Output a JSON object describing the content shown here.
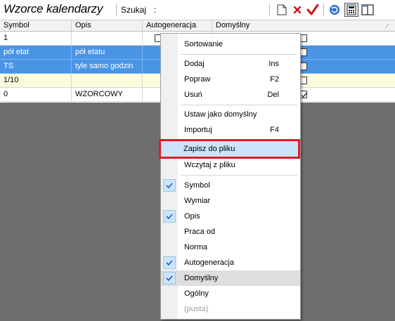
{
  "toolbar": {
    "title": "Wzorce kalendarzy",
    "search_label": "Szukaj",
    "search_colon": ":",
    "search_value": "",
    "icons": [
      "new-document-icon",
      "delete-icon",
      "confirm-check-icon",
      "refresh-icon",
      "calculator-icon",
      "panel-view-icon"
    ],
    "colors": {
      "delete": "#d0141a",
      "confirm": "#d0141a",
      "refresh": "#2f6fd6"
    }
  },
  "grid": {
    "columns": [
      "Symbol",
      "Opis",
      "Autogeneracja",
      "Domyślny"
    ],
    "rows": [
      {
        "symbol": "1",
        "opis": "",
        "domyslny": false,
        "style": "normal"
      },
      {
        "symbol": "pół etat",
        "opis": "pół etatu",
        "domyslny": false,
        "style": "selected"
      },
      {
        "symbol": "TS",
        "opis": "tyle samo godzin",
        "domyslny": false,
        "style": "selected"
      },
      {
        "symbol": "1/10",
        "opis": "",
        "domyslny": false,
        "style": "new"
      },
      {
        "symbol": "0",
        "opis": "WZORCOWY",
        "domyslny": true,
        "style": "normal"
      }
    ],
    "colors": {
      "selected": "#4a94e6",
      "new": "#fdfbdb",
      "background": "#6e6e6e"
    }
  },
  "context_menu": {
    "sortowanie": "Sortowanie",
    "dodaj": "Dodaj",
    "dodaj_sc": "Ins",
    "popraw": "Popraw",
    "popraw_sc": "F2",
    "usun": "Usuń",
    "usun_sc": "Del",
    "ustaw": "Ustaw jako domyślny",
    "importuj": "Importuj",
    "importuj_sc": "F4",
    "zapisz": "Zapisz do pliku",
    "wczytaj": "Wczytaj z pliku",
    "symbol": "Symbol",
    "wymiar": "Wymiar",
    "opis": "Opis",
    "praca_od": "Praca od",
    "norma": "Norma",
    "autogeneracja": "Autogeneracja",
    "domyslny": "Domyślny",
    "ogolny": "Ogólny",
    "pusta": "(pusta)",
    "checked": [
      "Symbol",
      "Opis",
      "Autogeneracja",
      "Domyślny"
    ],
    "highlight_color": "#e01c24"
  }
}
